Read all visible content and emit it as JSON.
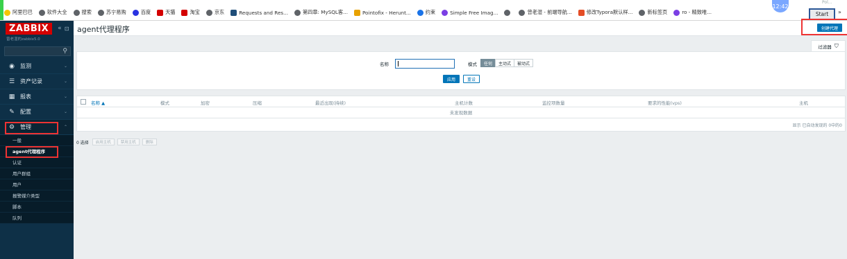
{
  "bookmarks": [
    {
      "label": "阿里巴巴",
      "color": "#f7c600"
    },
    {
      "label": "软件大全",
      "color": "#5f6368"
    },
    {
      "label": "搜索",
      "color": "#5f6368"
    },
    {
      "label": "苏宁易购",
      "color": "#5f6368"
    },
    {
      "label": "百度",
      "color": "#2932e1"
    },
    {
      "label": "天猫",
      "color": "#d40000"
    },
    {
      "label": "淘宝",
      "color": "#d40000"
    },
    {
      "label": "京东",
      "color": "#5f6368"
    },
    {
      "label": "Requests and Res...",
      "color": "#1f4e79"
    },
    {
      "label": "第四章: MySQL客...",
      "color": "#5f6368"
    },
    {
      "label": "Pointofix - Herunt...",
      "color": "#e8a200"
    },
    {
      "label": "约束",
      "color": "#1a73e8"
    },
    {
      "label": "Simple Free Imag...",
      "color": "#7b3fe4"
    },
    {
      "label": "",
      "color": "#5f6368"
    },
    {
      "label": "曾老湿 - 前端导航...",
      "color": "#5f6368"
    },
    {
      "label": "修改Typora默认样...",
      "color": "#e44d26"
    },
    {
      "label": "新标签页",
      "color": "#5f6368"
    },
    {
      "label": "ro - 精致唯...",
      "color": "#7b3fe4"
    }
  ],
  "browser": {
    "clock": "12:42",
    "start": "Start",
    "more": "»",
    "pol": "Pol..."
  },
  "sidebar": {
    "logo": "ZABBIX",
    "collapse": "«",
    "kiosk": "⊡",
    "server": "曾老湿的zabbix5.0",
    "menu": [
      {
        "label": "监测",
        "icon": "eye-icon"
      },
      {
        "label": "资产记录",
        "icon": "list-icon"
      },
      {
        "label": "报表",
        "icon": "chart-icon"
      },
      {
        "label": "配置",
        "icon": "wrench-icon"
      },
      {
        "label": "管理",
        "icon": "gear-icon"
      }
    ],
    "admin_sub": [
      "一般",
      "agent代理程序",
      "认证",
      "用户群组",
      "用户",
      "报警媒介类型",
      "脚本",
      "队列"
    ]
  },
  "main": {
    "title": "agent代理程序",
    "create_button": "创建代理"
  },
  "filter": {
    "tab": "过滤器",
    "name_label": "名称",
    "name_value": "",
    "mode_label": "模式",
    "modes": [
      "任何",
      "主动式",
      "被动式"
    ],
    "apply": "应用",
    "reset": "重设"
  },
  "table": {
    "columns": [
      "名称 ▲",
      "模式",
      "加密",
      "压缩",
      "最近出现(持续)",
      "主机计数",
      "监控项数量",
      "要求的性能(vps)",
      "主机"
    ],
    "no_data": "未发现数据",
    "summary": "显示 已自动发现的 0中的0"
  },
  "actions": {
    "selected": "0 选择",
    "buttons": [
      "启用主机",
      "禁用主机",
      "删除"
    ]
  }
}
